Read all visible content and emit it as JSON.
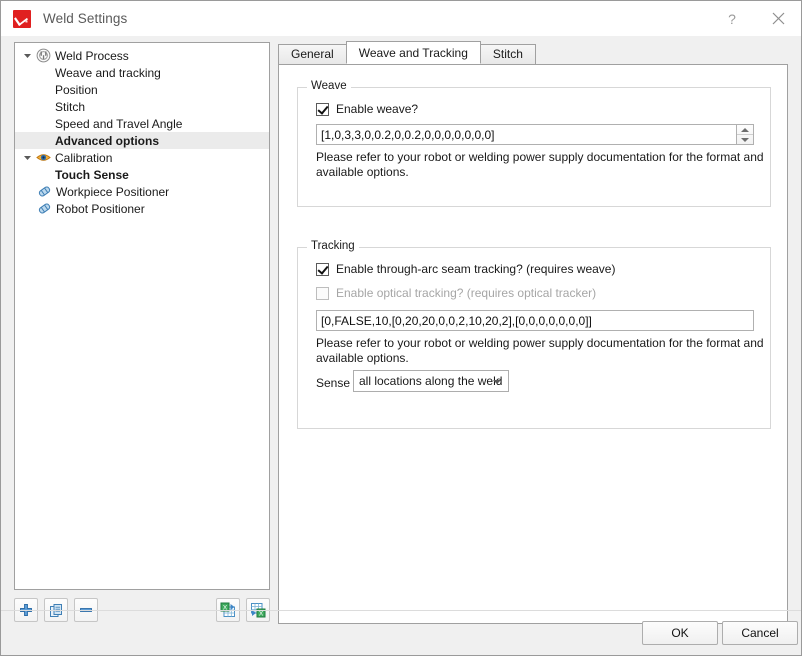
{
  "window": {
    "title": "Weld Settings",
    "help_label": "?",
    "close_label": "×"
  },
  "tree": {
    "items": [
      {
        "label": "Weld Process",
        "icon": "weld-process-icon",
        "level": 0,
        "expanded": true,
        "bold": false,
        "selected": false
      },
      {
        "label": "Weave and tracking",
        "icon": "",
        "level": 2,
        "bold": false,
        "selected": false
      },
      {
        "label": "Position",
        "icon": "",
        "level": 2,
        "bold": false,
        "selected": false
      },
      {
        "label": "Stitch",
        "icon": "",
        "level": 2,
        "bold": false,
        "selected": false
      },
      {
        "label": "Speed and Travel Angle",
        "icon": "",
        "level": 2,
        "bold": false,
        "selected": false
      },
      {
        "label": "Advanced options",
        "icon": "",
        "level": 2,
        "bold": true,
        "selected": true
      },
      {
        "label": "Calibration",
        "icon": "eye-icon",
        "level": 0,
        "expanded": true,
        "bold": false,
        "selected": false
      },
      {
        "label": "Touch Sense",
        "icon": "",
        "level": 2,
        "bold": true,
        "selected": false
      },
      {
        "label": "Workpiece Positioner",
        "icon": "positioner-icon",
        "level": 1,
        "bold": false,
        "selected": false
      },
      {
        "label": "Robot Positioner",
        "icon": "positioner-icon",
        "level": 1,
        "bold": false,
        "selected": false
      }
    ],
    "toolbar": {
      "add": "add-icon",
      "duplicate": "duplicate-icon",
      "remove": "remove-icon",
      "import_excel": "import-excel-icon",
      "export_excel": "export-excel-icon"
    }
  },
  "tabs": [
    {
      "label": "General",
      "active": false
    },
    {
      "label": "Weave and Tracking",
      "active": true
    },
    {
      "label": "Stitch",
      "active": false
    }
  ],
  "weave": {
    "group_title": "Weave",
    "enable_label": "Enable weave?",
    "enable_checked": true,
    "params_value": "[1,0,3,3,0,0.2,0,0.2,0,0,0,0,0,0,0]",
    "hint": "Please refer to your robot or welding power supply documentation for the format and available options."
  },
  "tracking": {
    "group_title": "Tracking",
    "arc_label": "Enable through-arc seam tracking? (requires weave)",
    "arc_checked": true,
    "optical_label": "Enable optical tracking? (requires optical tracker)",
    "optical_checked": false,
    "optical_disabled": true,
    "params_value": "[0,FALSE,10,[0,20,20,0,0,2,10,20,2],[0,0,0,0,0,0,0]]",
    "hint": "Please refer to your robot or welding power supply documentation for the format and available options.",
    "sense_label": "Sense",
    "sense_value": "all locations along the weld"
  },
  "footer": {
    "ok_label": "OK",
    "cancel_label": "Cancel"
  },
  "colors": {
    "accent_red": "#e02020",
    "selection_gray": "#ebebeb",
    "eye_orange": "#e8a020",
    "positioner_blue": "#2e86c8",
    "excel_green": "#3faa5e"
  }
}
